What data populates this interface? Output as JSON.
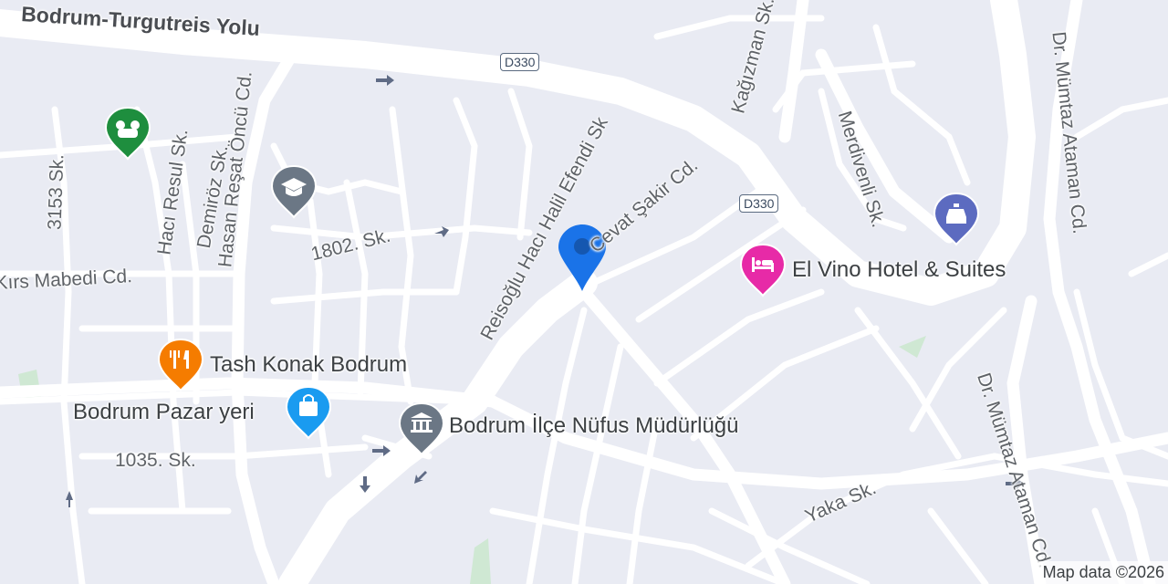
{
  "map": {
    "roads": {
      "main_highway": "Bodrum-Turgutreis Yolu",
      "hasan_resat": "Hasan Reşat Öncü Cd.",
      "haci_resul": "Hacı Resul Sk.",
      "demiroz": "Demiröz Sk.",
      "sk_3153": "3153 Sk.",
      "sk_1802": "1802. Sk.",
      "reisoglu": "Reisoğlu Hacı Halil Efendi Sk",
      "cevat_sakir": "Cevat Şakir Cd.",
      "kagizman": "Kağızman Sk.",
      "merdivenli": "Merdivenli Sk.",
      "mumtaz_ataman_1": "Dr. Mümtaz Ataman Cd.",
      "mumtaz_ataman_2": "Dr. Mümtaz Ataman Cd.",
      "kirs_mabedi": "Kırs Mabedi Cd.",
      "sk_1035": "1035. Sk.",
      "yaka": "Yaka Sk."
    },
    "shields": [
      "D330",
      "D330"
    ],
    "pois": {
      "hotel": {
        "name": "El Vino Hotel & Suites",
        "icon": "bed-icon",
        "color": "#e72aa7"
      },
      "restaurant": {
        "name": "Tash Konak Bodrum",
        "icon": "fork-knife-icon",
        "color": "#f57c00"
      },
      "market": {
        "name": "Bodrum Pazar yeri",
        "icon": "shopping-bag-icon",
        "color": "#1a9bf0"
      },
      "registry": {
        "name": "Bodrum İlçe Nüfus Müdürlüğü",
        "icon": "government-building-icon",
        "color": "#6b7785"
      },
      "school": {
        "icon": "graduation-cap-icon",
        "color": "#6b7785"
      },
      "car_service": {
        "icon": "car-icon",
        "color": "#5c6bc0"
      },
      "vet": {
        "icon": "animal-icon",
        "color": "#1e8e3e"
      }
    },
    "location_pin_color": "#1a73e8",
    "footer": "Map data ©2026"
  }
}
